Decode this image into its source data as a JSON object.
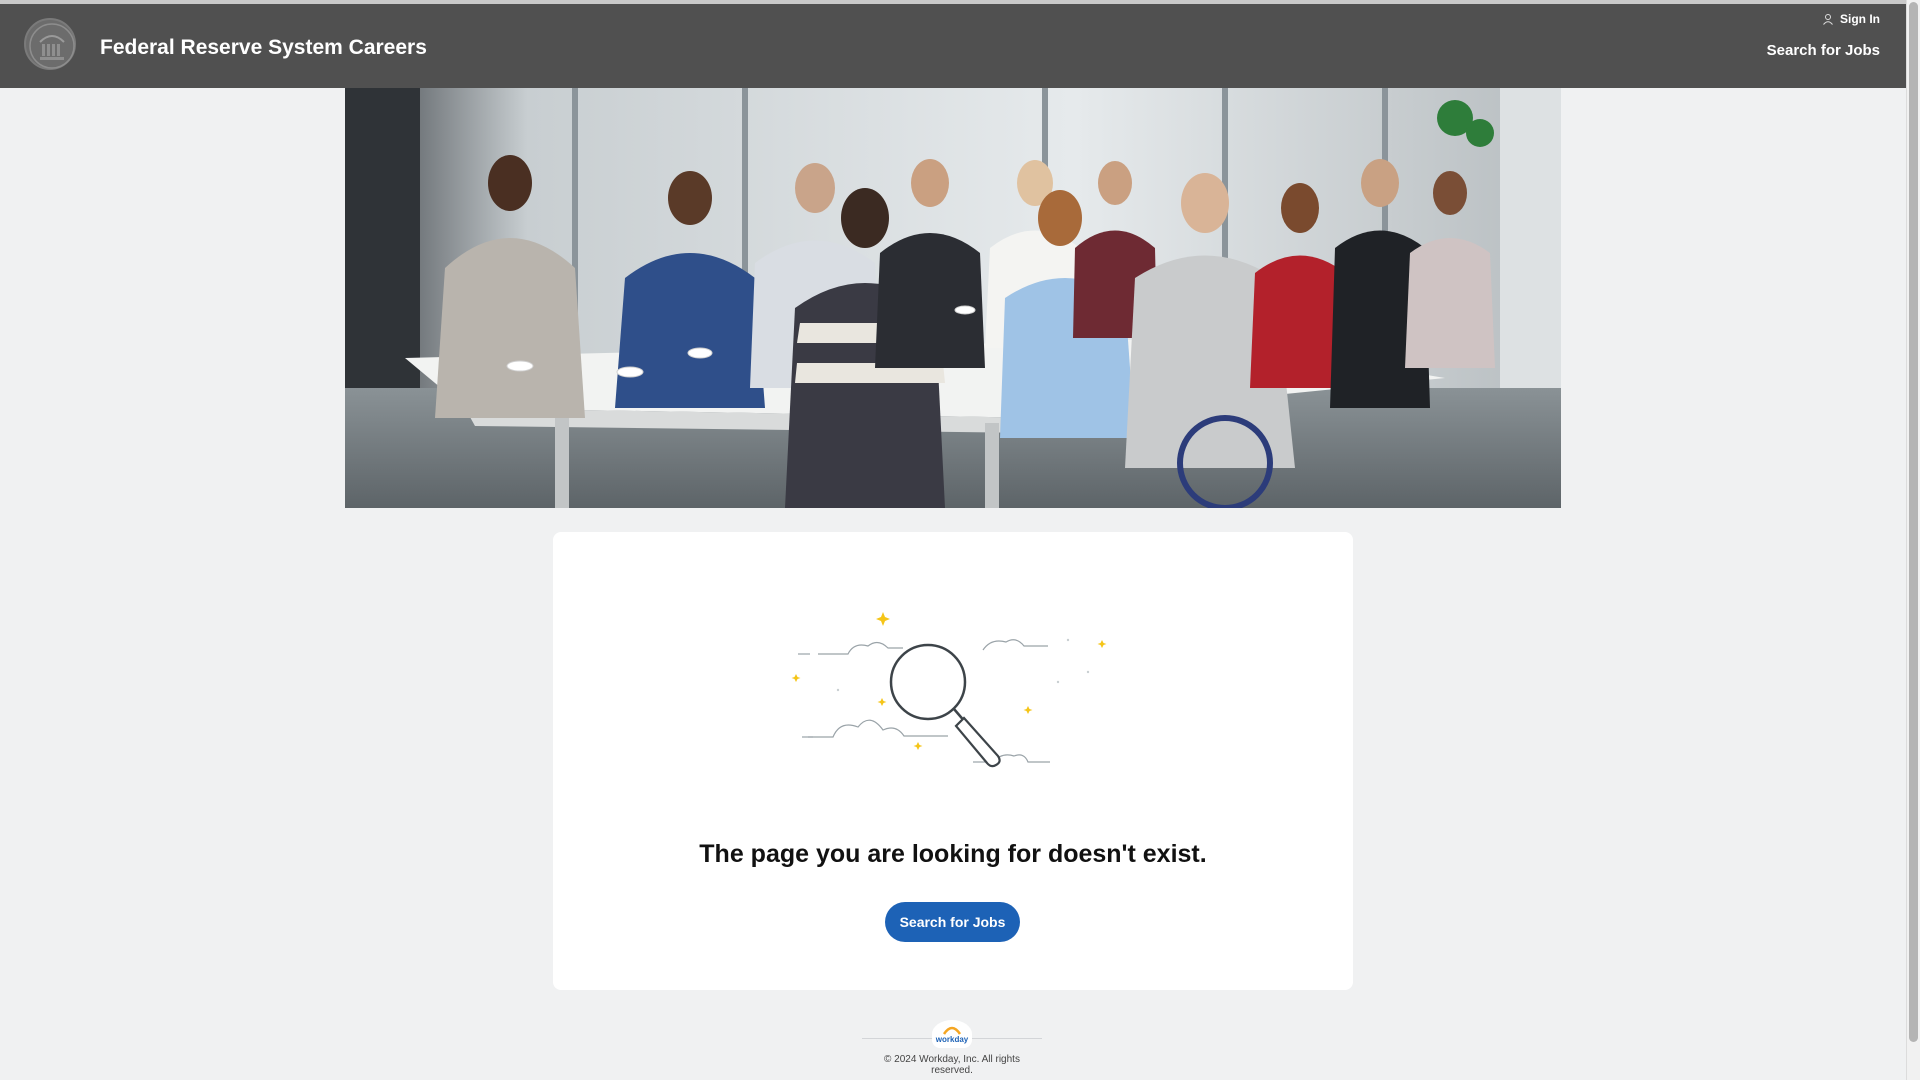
{
  "header": {
    "site_title": "Federal Reserve System Careers",
    "sign_in_label": "Sign In",
    "search_jobs_label": "Search for Jobs"
  },
  "hero": {
    "image_alt": "Group of professionals seated around a conference table in an office meeting room"
  },
  "card": {
    "message": "The page you are looking for doesn't exist.",
    "search_button_label": "Search for Jobs"
  },
  "footer": {
    "brand": "workday",
    "copyright": "© 2024 Workday, Inc. All rights reserved."
  },
  "colors": {
    "header_bg": "#505050",
    "page_bg": "#f0f1f2",
    "primary_button": "#1d62b6",
    "sparkle": "#f5c518"
  }
}
